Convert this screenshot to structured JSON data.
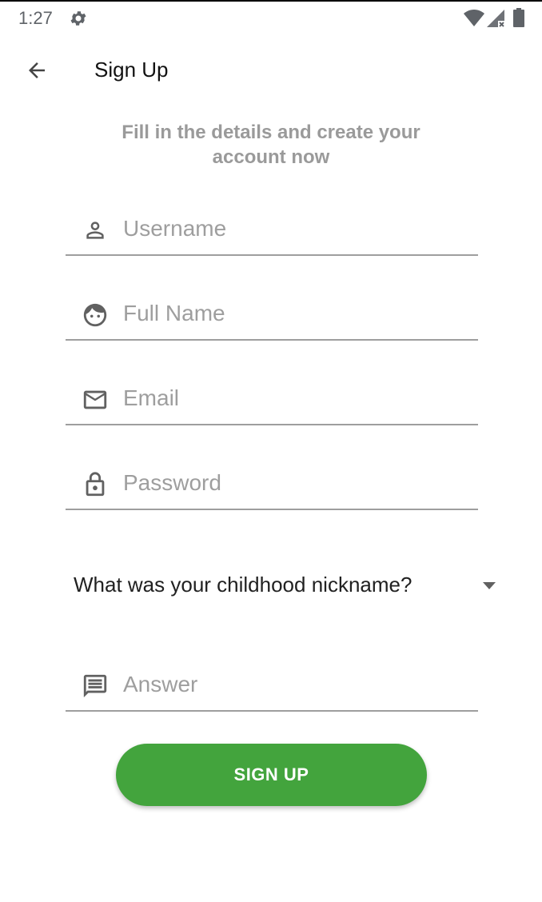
{
  "status_bar": {
    "time": "1:27",
    "icons": [
      "gear-icon",
      "wifi-icon",
      "cell-signal-icon",
      "battery-icon"
    ]
  },
  "app_bar": {
    "title": "Sign Up",
    "back_icon": "arrow-back-icon"
  },
  "subtitle": {
    "line1": "Fill in the details and create your",
    "line2": "account now"
  },
  "fields": [
    {
      "placeholder": "Username",
      "value": "",
      "icon": "person-icon"
    },
    {
      "placeholder": "Full Name",
      "value": "",
      "icon": "face-icon"
    },
    {
      "placeholder": "Email",
      "value": "",
      "icon": "mail-icon"
    },
    {
      "placeholder": "Password",
      "value": "",
      "icon": "lock-icon"
    }
  ],
  "security_question": {
    "selected": "What was your childhood nickname?",
    "icon": "dropdown-arrow-icon"
  },
  "answer_field": {
    "placeholder": "Answer",
    "value": "",
    "icon": "chat-message-icon"
  },
  "signup_button": {
    "label": "SIGN UP"
  },
  "colors": {
    "primary": "#43a43d",
    "placeholder": "#9e9e9e",
    "subtitle": "#9a9a9a"
  }
}
